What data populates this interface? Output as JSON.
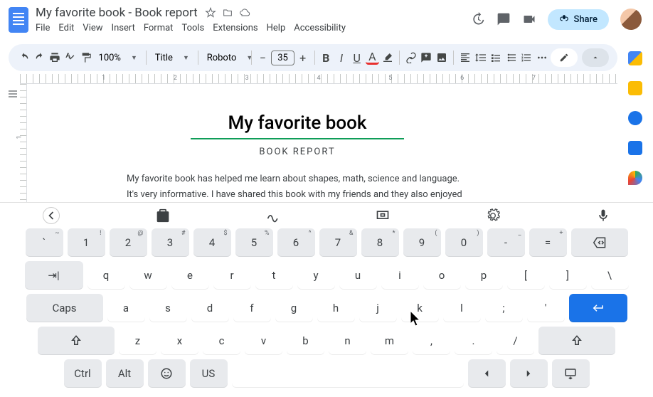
{
  "document": {
    "title": "My favorite book - Book report",
    "heading": "My favorite book",
    "subheading": "BOOK REPORT",
    "paragraph1": "My favorite book has helped me learn about shapes, math, science and language.",
    "paragraph2": "It's very informative. I have shared this book with my friends and they also enjoyed reading"
  },
  "menubar": [
    "File",
    "Edit",
    "View",
    "Insert",
    "Format",
    "Tools",
    "Extensions",
    "Help",
    "Accessibility"
  ],
  "toolbar": {
    "zoom": "100%",
    "style": "Title",
    "font": "Roboto",
    "fontsize": "35"
  },
  "share": "Share",
  "ruler_nums": [
    "1",
    "2",
    "3",
    "4",
    "5",
    "6",
    "7"
  ],
  "keyboard": {
    "row1": [
      {
        "main": "`",
        "sup": "~"
      },
      {
        "main": "1",
        "sup": "!"
      },
      {
        "main": "2",
        "sup": "@"
      },
      {
        "main": "3",
        "sup": "#"
      },
      {
        "main": "4",
        "sup": "$"
      },
      {
        "main": "5",
        "sup": "%"
      },
      {
        "main": "6",
        "sup": "^"
      },
      {
        "main": "7",
        "sup": "&"
      },
      {
        "main": "8",
        "sup": "*"
      },
      {
        "main": "9",
        "sup": "("
      },
      {
        "main": "0",
        "sup": ")"
      },
      {
        "main": "-",
        "sup": "_"
      },
      {
        "main": "=",
        "sup": "+"
      }
    ],
    "row2": [
      "q",
      "w",
      "e",
      "r",
      "t",
      "y",
      "u",
      "i",
      "o",
      "p",
      "[",
      "]",
      "\\"
    ],
    "row3_caps": "Caps",
    "row3": [
      "a",
      "s",
      "d",
      "f",
      "g",
      "h",
      "j",
      "k",
      "l",
      ";",
      "'"
    ],
    "row4": [
      "z",
      "x",
      "c",
      "v",
      "b",
      "n",
      "m",
      ",",
      ".",
      "/"
    ],
    "row5": {
      "ctrl": "Ctrl",
      "alt": "Alt",
      "lang": "US"
    }
  }
}
